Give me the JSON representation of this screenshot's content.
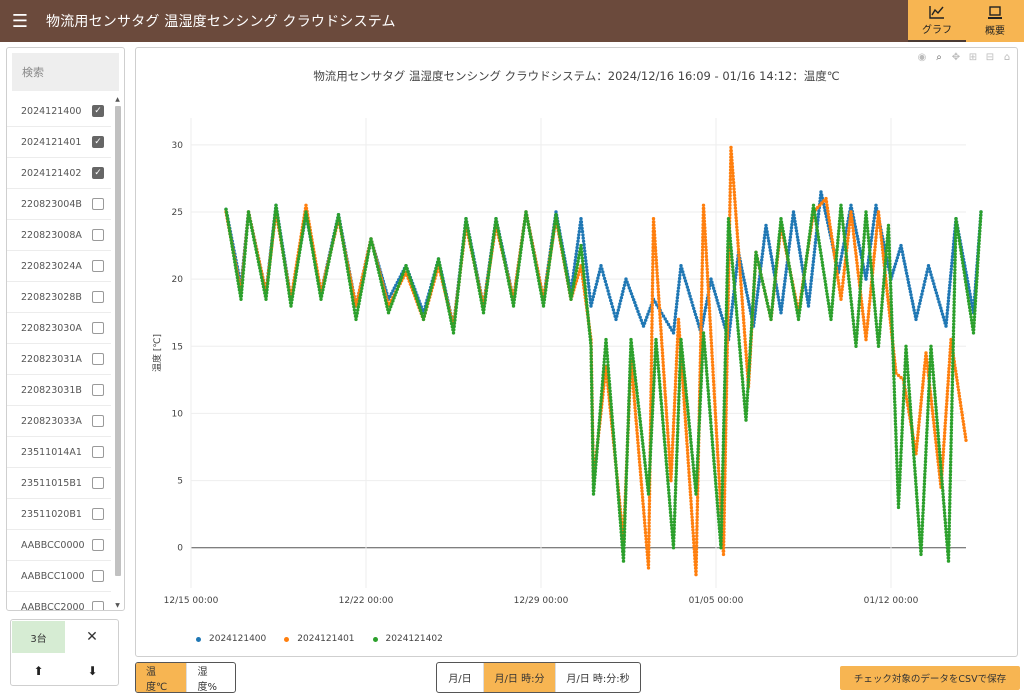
{
  "header": {
    "title": "物流用センサタグ 温湿度センシング クラウドシステム",
    "tabs": [
      {
        "label": "グラフ",
        "icon": "line-chart-icon",
        "active": true
      },
      {
        "label": "概要",
        "icon": "device-icon",
        "active": false
      }
    ]
  },
  "sidebar": {
    "search_placeholder": "検索",
    "devices": [
      {
        "id": "2024121400",
        "checked": true
      },
      {
        "id": "2024121401",
        "checked": true
      },
      {
        "id": "2024121402",
        "checked": true
      },
      {
        "id": "220823004B",
        "checked": false
      },
      {
        "id": "220823008A",
        "checked": false
      },
      {
        "id": "220823024A",
        "checked": false
      },
      {
        "id": "220823028B",
        "checked": false
      },
      {
        "id": "220823030A",
        "checked": false
      },
      {
        "id": "220823031A",
        "checked": false
      },
      {
        "id": "220823031B",
        "checked": false
      },
      {
        "id": "220823033A",
        "checked": false
      },
      {
        "id": "23511014A1",
        "checked": false
      },
      {
        "id": "23511015B1",
        "checked": false
      },
      {
        "id": "23511020B1",
        "checked": false
      },
      {
        "id": "AABBCC0000",
        "checked": false
      },
      {
        "id": "AABBCC1000",
        "checked": false
      },
      {
        "id": "AABBCC2000",
        "checked": false
      }
    ],
    "selected_count": "3台",
    "clear_label": "✕",
    "upload_label": "⬆",
    "download_label": "⬇"
  },
  "chart_data": {
    "type": "scatter",
    "title": "物流用センサタグ 温湿度センシング クラウドシステム：2024/12/16 16:09 - 01/16 14:12：温度℃",
    "ylabel": "温度 [℃]",
    "xlabel": "",
    "ylim": [
      -3,
      32
    ],
    "yticks": [
      0,
      5,
      10,
      15,
      20,
      25,
      30
    ],
    "xtick_labels": [
      "12/15 00:00",
      "12/22 00:00",
      "12/29 00:00",
      "01/05 00:00",
      "01/12 00:00"
    ],
    "x_range_days": [
      0,
      31
    ],
    "xtick_days": [
      0,
      7,
      14,
      21,
      28
    ],
    "grid": true,
    "legend_position": "bottom-left",
    "series": [
      {
        "name": "2024121400",
        "color": "#1f77b4",
        "points": [
          [
            1.4,
            25.2
          ],
          [
            2.0,
            19.5
          ],
          [
            2.3,
            25.0
          ],
          [
            3.0,
            19.0
          ],
          [
            3.4,
            25.5
          ],
          [
            4.0,
            18.5
          ],
          [
            4.6,
            24.8
          ],
          [
            5.2,
            19.0
          ],
          [
            5.9,
            24.8
          ],
          [
            6.6,
            18.0
          ],
          [
            7.2,
            23.0
          ],
          [
            7.9,
            18.5
          ],
          [
            8.6,
            21.0
          ],
          [
            9.3,
            17.5
          ],
          [
            9.9,
            21.5
          ],
          [
            10.5,
            16.5
          ],
          [
            11.0,
            24.5
          ],
          [
            11.7,
            18.0
          ],
          [
            12.2,
            24.5
          ],
          [
            12.9,
            18.5
          ],
          [
            13.4,
            25.0
          ],
          [
            14.1,
            18.5
          ],
          [
            14.6,
            25.0
          ],
          [
            15.2,
            19.0
          ],
          [
            15.6,
            24.5
          ],
          [
            16.0,
            18.0
          ],
          [
            16.4,
            21.0
          ],
          [
            17.0,
            17.0
          ],
          [
            17.4,
            20.0
          ],
          [
            18.1,
            16.5
          ],
          [
            18.5,
            18.5
          ],
          [
            19.3,
            16.0
          ],
          [
            19.6,
            21.0
          ],
          [
            20.4,
            16.0
          ],
          [
            20.8,
            20.0
          ],
          [
            21.5,
            15.5
          ],
          [
            21.9,
            22.0
          ],
          [
            22.5,
            16.5
          ],
          [
            23.0,
            24.0
          ],
          [
            23.6,
            17.5
          ],
          [
            24.1,
            25.0
          ],
          [
            24.7,
            18.0
          ],
          [
            25.2,
            26.5
          ],
          [
            25.9,
            20.5
          ],
          [
            26.4,
            25.5
          ],
          [
            27.0,
            20.0
          ],
          [
            27.4,
            25.5
          ],
          [
            28.0,
            20.0
          ],
          [
            28.4,
            22.5
          ],
          [
            29.0,
            17.0
          ],
          [
            29.5,
            21.0
          ],
          [
            30.2,
            16.5
          ],
          [
            30.6,
            24.5
          ],
          [
            31.3,
            17.5
          ],
          [
            31.6,
            25.0
          ]
        ]
      },
      {
        "name": "2024121401",
        "color": "#ff7f0e",
        "points": [
          [
            1.4,
            25.0
          ],
          [
            2.0,
            19.0
          ],
          [
            2.3,
            25.0
          ],
          [
            3.0,
            19.0
          ],
          [
            3.4,
            25.0
          ],
          [
            4.0,
            18.5
          ],
          [
            4.6,
            25.5
          ],
          [
            5.2,
            19.0
          ],
          [
            5.9,
            24.5
          ],
          [
            6.6,
            18.0
          ],
          [
            7.2,
            23.0
          ],
          [
            7.9,
            18.0
          ],
          [
            8.6,
            20.5
          ],
          [
            9.3,
            17.0
          ],
          [
            9.9,
            21.0
          ],
          [
            10.5,
            16.5
          ],
          [
            11.0,
            24.0
          ],
          [
            11.7,
            18.0
          ],
          [
            12.2,
            24.0
          ],
          [
            12.9,
            18.5
          ],
          [
            13.4,
            25.0
          ],
          [
            14.1,
            18.5
          ],
          [
            14.6,
            24.5
          ],
          [
            15.2,
            18.5
          ],
          [
            15.6,
            21.0
          ],
          [
            16.0,
            15.5
          ],
          [
            16.1,
            5.0
          ],
          [
            16.6,
            13.5
          ],
          [
            17.3,
            0.5
          ],
          [
            17.6,
            14.0
          ],
          [
            18.3,
            -1.5
          ],
          [
            18.5,
            24.5
          ],
          [
            19.2,
            5.0
          ],
          [
            19.5,
            17.0
          ],
          [
            20.2,
            -2.0
          ],
          [
            20.5,
            25.5
          ],
          [
            21.3,
            -0.5
          ],
          [
            21.6,
            29.8
          ],
          [
            22.3,
            12.0
          ],
          [
            22.6,
            22.0
          ],
          [
            23.2,
            17.0
          ],
          [
            23.6,
            24.0
          ],
          [
            24.3,
            17.5
          ],
          [
            24.9,
            25.0
          ],
          [
            25.4,
            26.0
          ],
          [
            26.0,
            18.5
          ],
          [
            26.4,
            25.0
          ],
          [
            27.0,
            15.5
          ],
          [
            27.5,
            25.0
          ],
          [
            28.2,
            13.0
          ],
          [
            28.5,
            12.5
          ],
          [
            29.0,
            7.0
          ],
          [
            29.4,
            14.5
          ],
          [
            30.0,
            4.5
          ],
          [
            30.4,
            15.5
          ],
          [
            31.0,
            8.0
          ]
        ]
      },
      {
        "name": "2024121402",
        "color": "#2ca02c",
        "points": [
          [
            1.4,
            25.2
          ],
          [
            2.0,
            18.5
          ],
          [
            2.3,
            25.0
          ],
          [
            3.0,
            18.5
          ],
          [
            3.4,
            25.5
          ],
          [
            4.0,
            18.0
          ],
          [
            4.6,
            25.0
          ],
          [
            5.2,
            18.5
          ],
          [
            5.9,
            24.8
          ],
          [
            6.6,
            17.0
          ],
          [
            7.2,
            23.0
          ],
          [
            7.9,
            17.5
          ],
          [
            8.6,
            21.0
          ],
          [
            9.3,
            17.0
          ],
          [
            9.9,
            21.5
          ],
          [
            10.5,
            16.0
          ],
          [
            11.0,
            24.5
          ],
          [
            11.7,
            17.5
          ],
          [
            12.2,
            24.5
          ],
          [
            12.9,
            18.0
          ],
          [
            13.4,
            25.0
          ],
          [
            14.1,
            18.0
          ],
          [
            14.6,
            24.8
          ],
          [
            15.2,
            18.5
          ],
          [
            15.6,
            22.5
          ],
          [
            16.0,
            15.0
          ],
          [
            16.1,
            4.0
          ],
          [
            16.6,
            15.5
          ],
          [
            17.3,
            -1.0
          ],
          [
            17.6,
            15.5
          ],
          [
            18.3,
            4.0
          ],
          [
            18.6,
            15.5
          ],
          [
            19.3,
            0.0
          ],
          [
            19.6,
            15.5
          ],
          [
            20.2,
            4.0
          ],
          [
            20.5,
            16.0
          ],
          [
            21.2,
            0.0
          ],
          [
            21.5,
            24.5
          ],
          [
            22.2,
            9.5
          ],
          [
            22.6,
            22.0
          ],
          [
            23.2,
            17.0
          ],
          [
            23.6,
            24.5
          ],
          [
            24.3,
            17.0
          ],
          [
            24.9,
            25.5
          ],
          [
            25.6,
            17.0
          ],
          [
            26.0,
            25.5
          ],
          [
            26.6,
            15.0
          ],
          [
            27.0,
            25.0
          ],
          [
            27.5,
            15.0
          ],
          [
            27.9,
            24.0
          ],
          [
            28.3,
            3.0
          ],
          [
            28.6,
            15.0
          ],
          [
            29.2,
            -0.5
          ],
          [
            29.6,
            15.0
          ],
          [
            30.3,
            -1.0
          ],
          [
            30.6,
            24.5
          ],
          [
            31.3,
            16.0
          ],
          [
            31.6,
            25.0
          ]
        ]
      }
    ]
  },
  "bottom": {
    "unit_buttons": [
      {
        "label": "温度℃",
        "active": true
      },
      {
        "label": "湿度%",
        "active": false
      }
    ],
    "format_buttons": [
      {
        "label": "月/日",
        "active": false
      },
      {
        "label": "月/日 時:分",
        "active": true
      },
      {
        "label": "月/日 時:分:秒",
        "active": false
      }
    ],
    "csv_label": "チェック対象のデータをCSVで保存"
  }
}
